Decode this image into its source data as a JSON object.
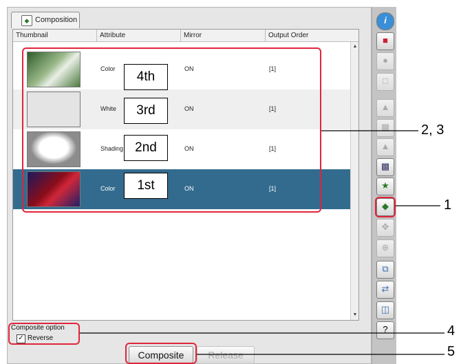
{
  "tab": {
    "label": "Composition",
    "icon": "composition-icon"
  },
  "table": {
    "headers": [
      "Thumbnail",
      "Attribute",
      "Mirror",
      "Output Order"
    ],
    "rows": [
      {
        "attribute": "Color",
        "mirror": "ON",
        "order": "[1]",
        "selected": false,
        "badge": "4th"
      },
      {
        "attribute": "White",
        "mirror": "ON",
        "order": "[1]",
        "selected": false,
        "badge": "3rd"
      },
      {
        "attribute": "Shading",
        "mirror": "ON",
        "order": "[1]",
        "selected": false,
        "badge": "2nd"
      },
      {
        "attribute": "Color",
        "mirror": "ON",
        "order": "[1]",
        "selected": true,
        "badge": "1st"
      }
    ]
  },
  "composite_option": {
    "title": "Composite option",
    "reverse_label": "Reverse",
    "reverse_checked": true
  },
  "buttons": {
    "composite": "Composite",
    "release": "Release"
  },
  "callouts": {
    "c1": "1",
    "c23": "2, 3",
    "c4": "4",
    "c5": "5"
  },
  "toolbar_icons": [
    "info-icon",
    "add-layer-icon",
    "circle-icon",
    "frame-icon",
    "merge-icon",
    "grid-icon",
    "copy-icon",
    "layout-icon",
    "star-swap-icon",
    "composition-icon",
    "move-icon",
    "target-icon",
    "duplicate-icon",
    "exchange-icon",
    "trash-icon",
    "help-icon"
  ],
  "colors": {
    "selected_row": "#336b8e",
    "highlight": "#e0243a"
  }
}
